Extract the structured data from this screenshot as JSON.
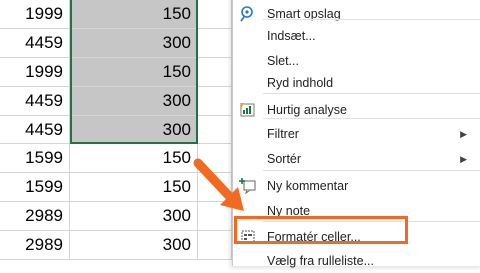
{
  "rows": [
    {
      "a": "1999",
      "b": "150"
    },
    {
      "a": "4459",
      "b": "300"
    },
    {
      "a": "1999",
      "b": "150"
    },
    {
      "a": "4459",
      "b": "300"
    },
    {
      "a": "4459",
      "b": "300"
    },
    {
      "a": "1599",
      "b": "150"
    },
    {
      "a": "1599",
      "b": "150"
    },
    {
      "a": "2989",
      "b": "300"
    },
    {
      "a": "2989",
      "b": "300"
    }
  ],
  "menu": {
    "smart_lookup": "Smart opslag",
    "insert": "Indsæt...",
    "delete": "Slet...",
    "clear_contents": "Ryd indhold",
    "quick_analysis": "Hurtig analyse",
    "filter": "Filtrer",
    "sort": "Sortér",
    "new_comment": "Ny kommentar",
    "new_note": "Ny note",
    "format_cells": "Formatér celler...",
    "pick_from_list": "Vælg fra rulleliste..."
  },
  "colors": {
    "selection_fill": "#c6c6c6",
    "selection_border": "#217346",
    "callout_orange": "#f26a21"
  },
  "icons": {
    "smart_lookup": "search-icon",
    "quick_analysis": "quick-analysis-icon",
    "new_comment": "new-comment-icon",
    "format_cells": "format-cells-icon",
    "submenu": "chevron-right-icon",
    "callout": "arrow-pointer-icon"
  }
}
